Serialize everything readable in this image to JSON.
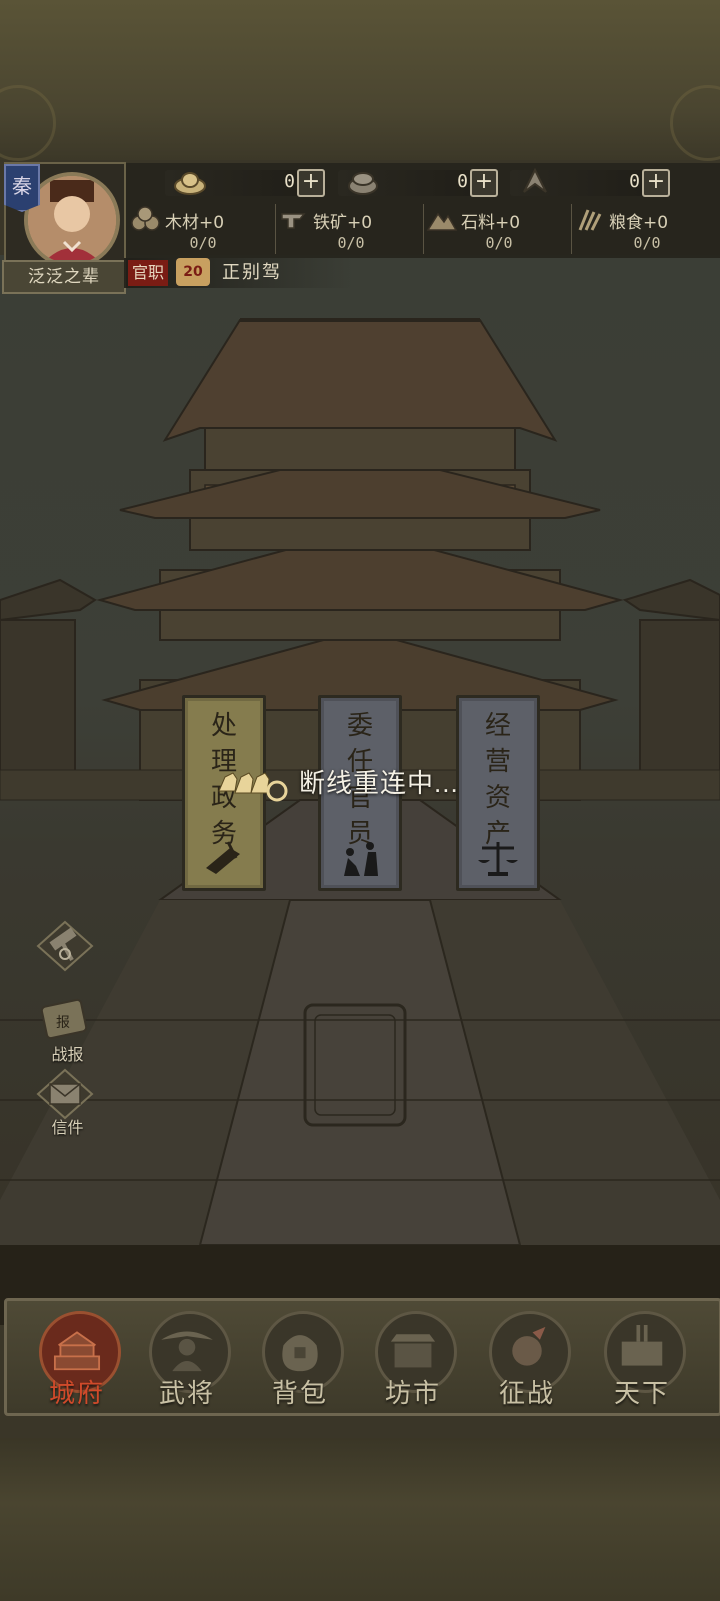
{
  "player": {
    "faction_badge": "秦",
    "name": "泛泛之辈",
    "rank_tag": "官职",
    "rank_level": "20",
    "rank_title": "正别驾"
  },
  "currencies": [
    {
      "icon": "gold-ingot-icon",
      "value": "0"
    },
    {
      "icon": "silver-ingot-icon",
      "value": "0"
    },
    {
      "icon": "token-icon",
      "value": "0"
    }
  ],
  "resources": [
    {
      "icon": "wood-icon",
      "label": "木材+0",
      "count": "0/0"
    },
    {
      "icon": "iron-ore-icon",
      "label": "铁矿+0",
      "count": "0/0"
    },
    {
      "icon": "stone-icon",
      "label": "石料+0",
      "count": "0/0"
    },
    {
      "icon": "grain-icon",
      "label": "粮食+0",
      "count": "0/0"
    }
  ],
  "banners": [
    {
      "text": "处理政务",
      "line1": "处",
      "line2": "理",
      "line3": "政",
      "line4": "务"
    },
    {
      "text": "委任官员",
      "line1": "委",
      "line2": "任",
      "line3": "官",
      "line4": "员"
    },
    {
      "text": "经营资产",
      "line1": "经",
      "line2": "营",
      "line3": "资",
      "line4": "产"
    }
  ],
  "status": {
    "message": "断线重连中..."
  },
  "side_buttons": [
    {
      "icon": "hammer-icon",
      "label": ""
    },
    {
      "icon": "battle-report-icon",
      "label": "战报"
    },
    {
      "icon": "mail-icon",
      "label": "信件"
    }
  ],
  "nav": [
    {
      "label": "城府",
      "icon": "city-hall-icon",
      "active": true
    },
    {
      "label": "武将",
      "icon": "general-icon",
      "active": false
    },
    {
      "label": "背包",
      "icon": "bag-icon",
      "active": false
    },
    {
      "label": "坊市",
      "icon": "market-icon",
      "active": false
    },
    {
      "label": "征战",
      "icon": "battle-icon",
      "active": false
    },
    {
      "label": "天下",
      "icon": "world-icon",
      "active": false
    }
  ],
  "colors": {
    "active_tab": "#d04a2a",
    "faction": "#2b4070",
    "rank_tag": "#7a1c14"
  }
}
